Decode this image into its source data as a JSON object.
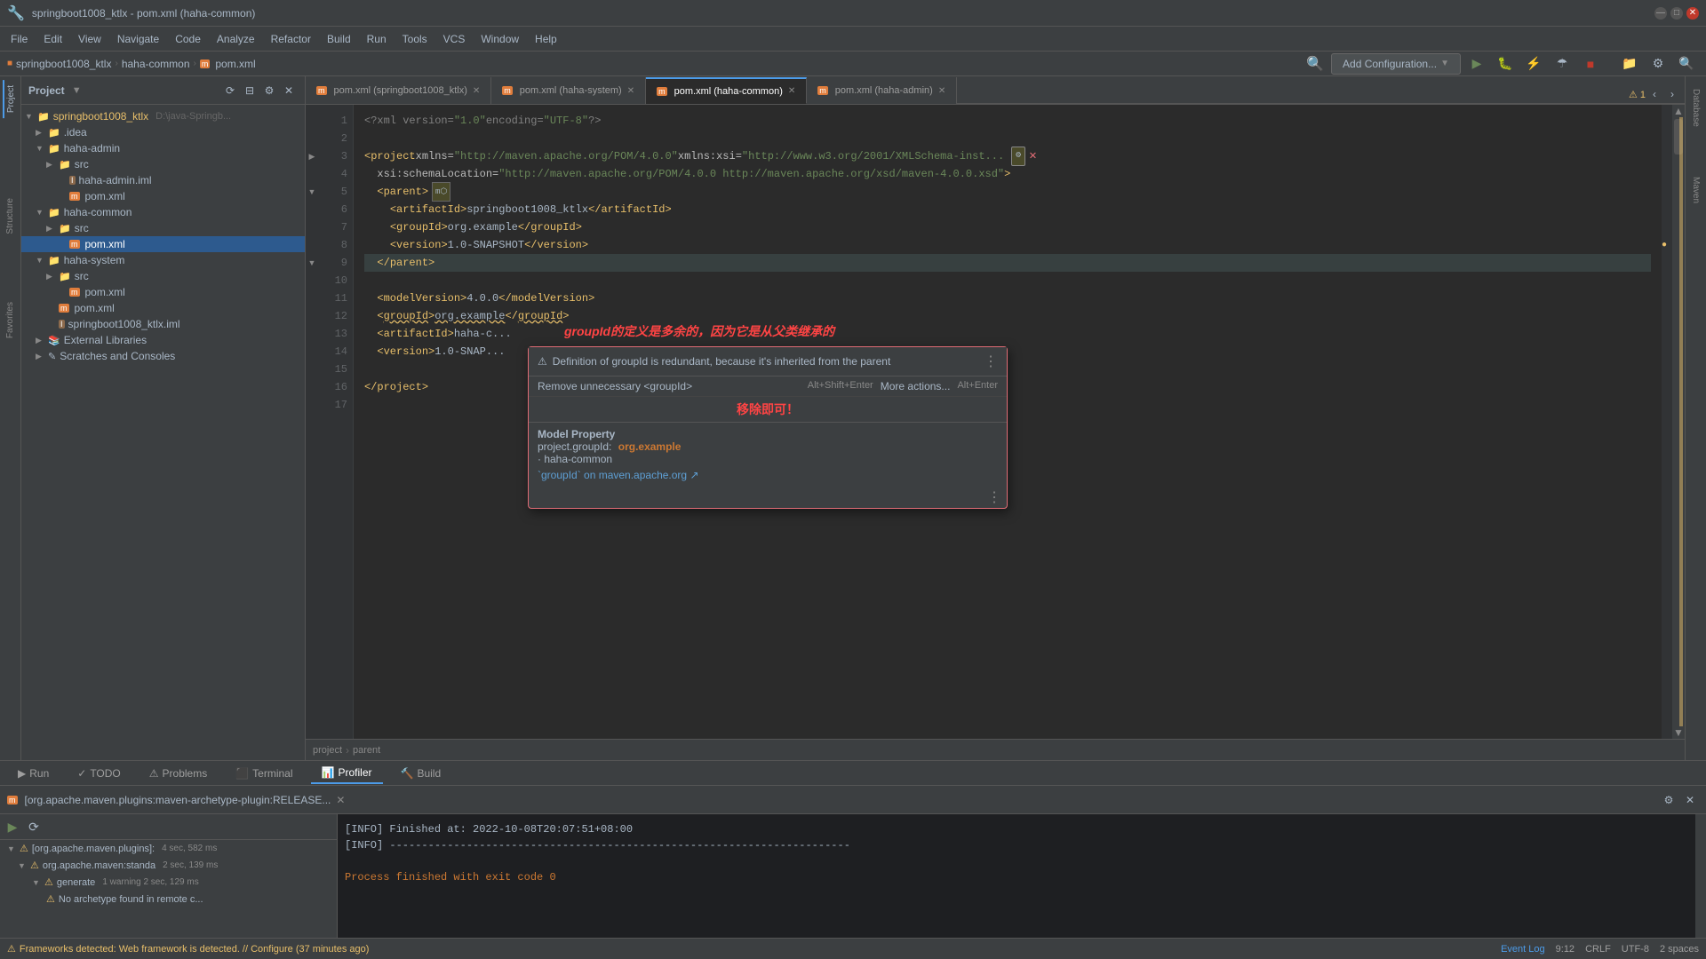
{
  "window": {
    "title": "springboot1008_ktlx - pom.xml (haha-common)",
    "min_btn": "—",
    "max_btn": "□",
    "close_btn": "✕"
  },
  "menu": {
    "items": [
      "File",
      "Edit",
      "View",
      "Navigate",
      "Code",
      "Analyze",
      "Refactor",
      "Build",
      "Run",
      "Tools",
      "VCS",
      "Window",
      "Help"
    ]
  },
  "breadcrumb": {
    "parts": [
      "springboot1008_ktlx",
      "haha-common",
      "pom.xml"
    ]
  },
  "toolbar": {
    "add_config_label": "Add Configuration...",
    "search_icon": "🔍"
  },
  "project_panel": {
    "title": "Project",
    "root": {
      "name": "springboot1008_ktlx",
      "path": "D:\\java-Springb...",
      "children": [
        {
          "type": "folder",
          "name": ".idea",
          "indent": 1
        },
        {
          "type": "folder",
          "name": "haha-admin",
          "indent": 1,
          "expanded": true,
          "children": [
            {
              "type": "folder",
              "name": "src",
              "indent": 2
            },
            {
              "type": "file-iml",
              "name": "haha-admin.iml",
              "indent": 3
            },
            {
              "type": "file-xml",
              "name": "pom.xml",
              "indent": 3
            }
          ]
        },
        {
          "type": "folder",
          "name": "haha-common",
          "indent": 1,
          "expanded": true,
          "children": [
            {
              "type": "folder",
              "name": "src",
              "indent": 2
            },
            {
              "type": "file-xml",
              "name": "pom.xml",
              "indent": 3,
              "selected": true
            }
          ]
        },
        {
          "type": "folder",
          "name": "haha-system",
          "indent": 1,
          "expanded": true,
          "children": [
            {
              "type": "folder",
              "name": "src",
              "indent": 2
            },
            {
              "type": "file-xml",
              "name": "pom.xml",
              "indent": 3
            }
          ]
        },
        {
          "type": "file-xml",
          "name": "pom.xml",
          "indent": 2
        },
        {
          "type": "file",
          "name": "springboot1008_ktlx.iml",
          "indent": 2
        },
        {
          "type": "folder",
          "name": "External Libraries",
          "indent": 1
        },
        {
          "type": "scratches",
          "name": "Scratches and Consoles",
          "indent": 1
        }
      ]
    }
  },
  "editor": {
    "tabs": [
      {
        "label": "pom.xml (springboot1008_ktlx)",
        "active": false
      },
      {
        "label": "pom.xml (haha-system)",
        "active": false
      },
      {
        "label": "pom.xml (haha-common)",
        "active": true
      },
      {
        "label": "pom.xml (haha-admin)",
        "active": false
      }
    ],
    "lines": [
      {
        "num": 1,
        "content": "<?xml version=\"1.0\" encoding=\"UTF-8\"?>",
        "type": "decl"
      },
      {
        "num": 2,
        "content": "",
        "type": "blank"
      },
      {
        "num": 3,
        "content": "<project xmlns=\"http://maven.apache.org/POM/4.0.0\" xmlns:xsi=\"http://www.w3.org/2001/XMLSchema-inst...",
        "type": "tag"
      },
      {
        "num": 4,
        "content": "  xsi:schemaLocation=\"http://maven.apache.org/POM/4.0.0 http://maven.apache.org/xsd/maven-4.0.0.xsd\">",
        "type": "attr"
      },
      {
        "num": 5,
        "content": "  <parent>",
        "type": "tag"
      },
      {
        "num": 6,
        "content": "    <artifactId>springboot1008_ktlx</artifactId>",
        "type": "tag"
      },
      {
        "num": 7,
        "content": "    <groupId>org.example</groupId>",
        "type": "tag"
      },
      {
        "num": 8,
        "content": "    <version>1.0-SNAPSHOT</version>",
        "type": "tag",
        "has_bullet": true
      },
      {
        "num": 9,
        "content": "  </parent>",
        "type": "tag",
        "highlighted": true
      },
      {
        "num": 10,
        "content": "",
        "type": "blank"
      },
      {
        "num": 11,
        "content": "  <modelVersion>4.0.0</modelVersion>",
        "type": "tag"
      },
      {
        "num": 12,
        "content": "  <groupId>org.example</groupId>",
        "type": "tag_warning"
      },
      {
        "num": 13,
        "content": "  <artifactId>haha-c...",
        "type": "tag"
      },
      {
        "num": 14,
        "content": "  <version>1.0-SNAP...",
        "type": "tag"
      },
      {
        "num": 15,
        "content": "",
        "type": "blank"
      },
      {
        "num": 16,
        "content": "</project>",
        "type": "tag",
        "has_fold": true
      },
      {
        "num": 17,
        "content": "",
        "type": "blank"
      }
    ]
  },
  "tooltip": {
    "chinese_warning": "groupId的定义是多余的，因为它是从父类继承的",
    "english_warning": "Definition of groupId is redundant, because it's inherited from the parent",
    "chinese_action": "移除即可！",
    "remove_action": "Remove unnecessary <groupId>",
    "remove_shortcut": "Alt+Shift+Enter",
    "more_actions": "More actions...",
    "more_shortcut": "Alt+Enter",
    "model_property_label": "Model Property",
    "project_groupid_label": "project.groupId:",
    "project_groupid_val": "org.example",
    "module_label": "· haha-common",
    "maven_link": "`groupId` on maven.apache.org ↗"
  },
  "bottom_breadcrumb": {
    "parts": [
      "project",
      "parent"
    ]
  },
  "run_panel": {
    "label": "[org.apache.maven.plugins:maven-archetype-plugin:RELEASE...",
    "close": "✕",
    "tree": [
      {
        "label": "[org.apache.maven.plugins]:",
        "indent": 0,
        "icon": "warning",
        "suffix": "4 sec, 582 ms"
      },
      {
        "label": "org.apache.maven:standa",
        "indent": 1,
        "icon": "warning",
        "suffix": "2 sec, 139 ms"
      },
      {
        "label": "generate",
        "indent": 2,
        "icon": "warning",
        "suffix": "1 warning  2 sec, 129 ms"
      },
      {
        "label": "No archetype found in remote c...",
        "indent": 3,
        "icon": "warning"
      }
    ],
    "output": [
      "[INFO] Finished at: 2022-10-08T20:07:51+08:00",
      "[INFO] ------------------------------------------------------------------------",
      "",
      "Process finished with exit code 0"
    ]
  },
  "bottom_tabs": [
    {
      "label": "Run",
      "icon": "▶",
      "active": false
    },
    {
      "label": "TODO",
      "icon": "✓",
      "active": false
    },
    {
      "label": "Problems",
      "icon": "⚠",
      "active": false
    },
    {
      "label": "Terminal",
      "icon": "⬛",
      "active": false
    },
    {
      "label": "Profiler",
      "icon": "📊",
      "active": true
    },
    {
      "label": "Build",
      "icon": "🔨",
      "active": false
    }
  ],
  "status_bar": {
    "frameworks_text": "Frameworks detected: Web framework is detected. // Configure (37 minutes ago)",
    "position": "9:12",
    "line_sep": "CRLF",
    "encoding": "UTF-8",
    "indent": "2 spaces",
    "event_log": "Event Log",
    "warnings": "⚠ 1"
  },
  "right_panels": [
    "Database",
    "Maven"
  ],
  "left_panels": [
    "Structure",
    "Favorites"
  ],
  "colors": {
    "active_tab_border": "#4c9be8",
    "selected_file": "#2d5a8e",
    "warning_yellow": "#e8bf6a",
    "error_red": "#ff4444",
    "tooltip_border": "#e06c75",
    "xml_tag": "#e8bf6a",
    "xml_string": "#6a8759"
  }
}
